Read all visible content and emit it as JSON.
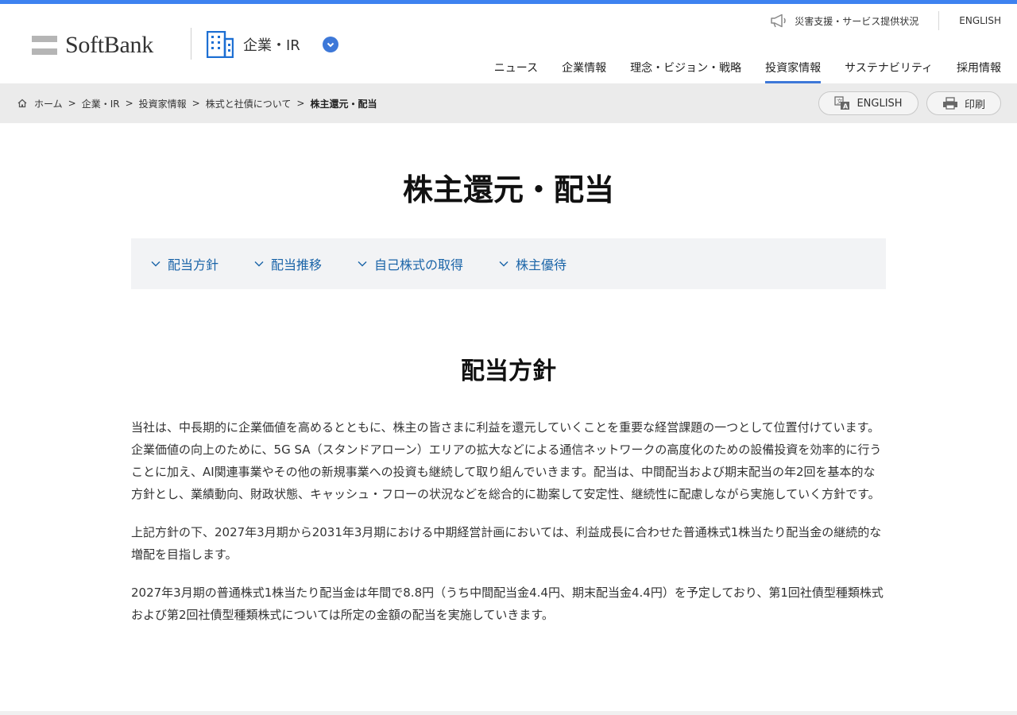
{
  "header": {
    "logo_text": "SoftBank",
    "section_label": "企業・IR",
    "util": {
      "disaster_label": "災害支援・サービス提供状況",
      "english_label": "ENGLISH"
    },
    "nav": [
      {
        "label": "ニュース",
        "active": false
      },
      {
        "label": "企業情報",
        "active": false
      },
      {
        "label": "理念・ビジョン・戦略",
        "active": false
      },
      {
        "label": "投資家情報",
        "active": true
      },
      {
        "label": "サステナビリティ",
        "active": false
      },
      {
        "label": "採用情報",
        "active": false
      }
    ],
    "accent_color": "#3d78d8"
  },
  "breadcrumb": {
    "items": [
      "ホーム",
      "企業・IR",
      "投資家情報",
      "株式と社債について"
    ],
    "current": "株主還元・配当",
    "separator": ">"
  },
  "actions": {
    "english_label": "ENGLISH",
    "print_label": "印刷"
  },
  "page_title": "株主還元・配当",
  "anchors": [
    "配当方針",
    "配当推移",
    "自己株式の取得",
    "株主優待"
  ],
  "section": {
    "title": "配当方針",
    "paragraphs": [
      "当社は、中長期的に企業価値を高めるとともに、株主の皆さまに利益を還元していくことを重要な経営課題の一つとして位置付けています。企業価値の向上のために、5G SA（スタンドアローン）エリアの拡大などによる通信ネットワークの高度化のための設備投資を効率的に行うことに加え、AI関連事業やその他の新規事業への投資も継続して取り組んでいきます。配当は、中間配当および期末配当の年2回を基本的な方針とし、業績動向、財政状態、キャッシュ・フローの状況などを総合的に勘案して安定性、継続性に配慮しながら実施していく方針です。",
      "上記方針の下、2027年3月期から2031年3月期における中期経営計画においては、利益成長に合わせた普通株式1株当たり配当金の継続的な増配を目指します。",
      "2027年3月期の普通株式1株当たり配当金は年間で8.8円（うち中間配当金4.4円、期末配当金4.4円）を予定しており、第1回社債型種類株式および第2回社債型種類株式については所定の金額の配当を実施していきます。"
    ]
  }
}
